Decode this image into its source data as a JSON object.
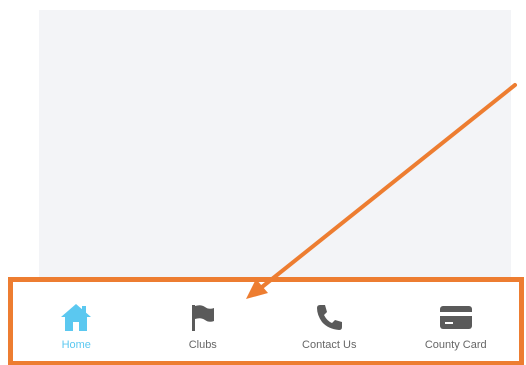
{
  "tabs": [
    {
      "label": "Home",
      "icon": "home-icon",
      "active": true
    },
    {
      "label": "Clubs",
      "icon": "flag-icon",
      "active": false
    },
    {
      "label": "Contact Us",
      "icon": "phone-icon",
      "active": false
    },
    {
      "label": "County Card",
      "icon": "credit-card-icon",
      "active": false
    }
  ],
  "colors": {
    "active": "#5bc8f0",
    "inactive_icon": "#5a5a5a",
    "inactive_label": "#666666",
    "highlight": "#ed7d31",
    "content_bg": "#f3f4f7"
  }
}
